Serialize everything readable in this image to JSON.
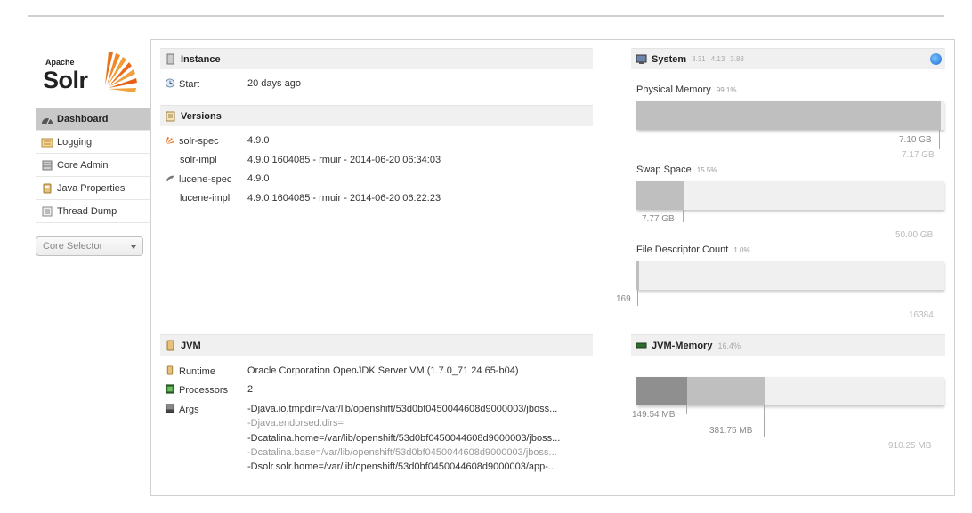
{
  "logo": {
    "apache": "Apache",
    "solr": "Solr"
  },
  "nav": [
    {
      "label": "Dashboard",
      "icon": "dashboard-icon",
      "active": true
    },
    {
      "label": "Logging",
      "icon": "logging-icon"
    },
    {
      "label": "Core Admin",
      "icon": "core-admin-icon"
    },
    {
      "label": "Java Properties",
      "icon": "java-properties-icon"
    },
    {
      "label": "Thread Dump",
      "icon": "thread-dump-icon"
    }
  ],
  "core_selector": {
    "placeholder": "Core Selector"
  },
  "instance": {
    "title": "Instance",
    "start_label": "Start",
    "start_value": "20 days ago"
  },
  "versions": {
    "title": "Versions",
    "rows": [
      {
        "label": "solr-spec",
        "value": "4.9.0"
      },
      {
        "label": "solr-impl",
        "value": "4.9.0 1604085 - rmuir - 2014-06-20 06:34:03"
      },
      {
        "label": "lucene-spec",
        "value": "4.9.0"
      },
      {
        "label": "lucene-impl",
        "value": "4.9.0 1604085 - rmuir - 2014-06-20 06:22:23"
      }
    ]
  },
  "jvm": {
    "title": "JVM",
    "runtime_label": "Runtime",
    "runtime_value": "Oracle Corporation OpenJDK Server VM (1.7.0_71 24.65-b04)",
    "processors_label": "Processors",
    "processors_value": "2",
    "args_label": "Args",
    "args": [
      "-Djava.io.tmpdir=/var/lib/openshift/53d0bf0450044608d9000003/jboss...",
      "-Djava.endorsed.dirs=",
      "-Dcatalina.home=/var/lib/openshift/53d0bf0450044608d9000003/jboss...",
      "-Dcatalina.base=/var/lib/openshift/53d0bf0450044608d9000003/jboss...",
      "-Dsolr.solr.home=/var/lib/openshift/53d0bf0450044608d9000003/app-..."
    ]
  },
  "system": {
    "title": "System",
    "load": [
      "3.31",
      "4.13",
      "3.83"
    ],
    "physical_memory": {
      "label": "Physical Memory",
      "pct": "99.1%",
      "used": "7.10 GB",
      "total": "7.17 GB",
      "fraction": 0.991
    },
    "swap_space": {
      "label": "Swap Space",
      "pct": "15.5%",
      "used": "7.77 GB",
      "total": "50.00 GB",
      "fraction": 0.155
    },
    "file_descriptor": {
      "label": "File Descriptor Count",
      "pct": "1.0%",
      "used": "169",
      "total": "16384",
      "fraction": 0.01
    }
  },
  "jvm_memory": {
    "title": "JVM-Memory",
    "pct": "16.4%",
    "used": "149.54 MB",
    "committed": "381.75 MB",
    "max": "910.25 MB",
    "used_fraction": 0.164,
    "committed_fraction": 0.419
  },
  "colors": {
    "bar_fill": "#bfbfbf",
    "bar_dark": "#8f8f8f",
    "track": "#f0f0f0",
    "active_nav": "#c8c8c8"
  }
}
